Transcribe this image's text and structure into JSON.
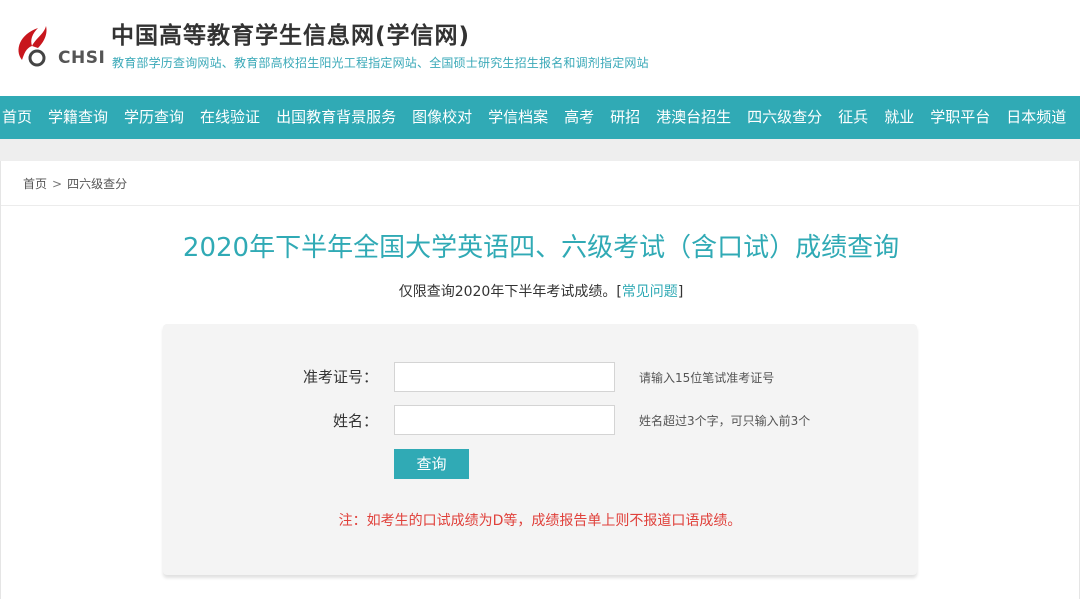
{
  "header": {
    "logo_text": "CHSI",
    "title": "中国高等教育学生信息网(学信网)",
    "subtitle": "教育部学历查询网站、教育部高校招生阳光工程指定网站、全国硕士研究生招生报名和调剂指定网站"
  },
  "nav": {
    "items": [
      {
        "label": "首页"
      },
      {
        "label": "学籍查询"
      },
      {
        "label": "学历查询"
      },
      {
        "label": "在线验证"
      },
      {
        "label": "出国教育背景服务"
      },
      {
        "label": "图像校对"
      },
      {
        "label": "学信档案"
      },
      {
        "label": "高考"
      },
      {
        "label": "研招"
      },
      {
        "label": "港澳台招生"
      },
      {
        "label": "四六级查分"
      },
      {
        "label": "征兵"
      },
      {
        "label": "就业"
      },
      {
        "label": "学职平台"
      },
      {
        "label": "日本频道"
      }
    ]
  },
  "breadcrumb": {
    "home": "首页",
    "separator": ">",
    "current": "四六级查分"
  },
  "page": {
    "title": "2020年下半年全国大学英语四、六级考试（含口试）成绩查询",
    "notice_text": "仅限查询2020年下半年考试成绩。",
    "notice_bracket_open": "[",
    "faq_link": "常见问题",
    "notice_bracket_close": "]"
  },
  "form": {
    "ticket_label": "准考证号：",
    "ticket_value": "",
    "ticket_hint": "请输入15位笔试准考证号",
    "name_label": "姓名：",
    "name_value": "",
    "name_hint": "姓名超过3个字，可只输入前3个",
    "submit_label": "查询",
    "warning": "注：如考生的口试成绩为D等，成绩报告单上则不报道口语成绩。"
  },
  "colors": {
    "accent": "#30aab5",
    "warning": "#e0413b",
    "logo_red": "#c8161d"
  }
}
